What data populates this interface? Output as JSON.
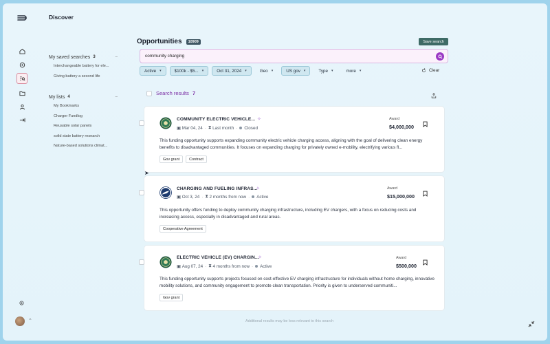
{
  "page": {
    "title": "Discover"
  },
  "sidebar": {
    "saved_searches": {
      "title": "My saved searches",
      "count": "3",
      "items": [
        "Interchangeable battery for ele...",
        "Giving battery a second life"
      ]
    },
    "my_lists": {
      "title": "My lists",
      "count": "4",
      "items": [
        "My Bookmarks",
        "Charger Fundlog",
        "Reusable solar panels",
        "solid state battery research",
        "Nature-based solutions climat..."
      ]
    }
  },
  "main": {
    "title": "Opportunities",
    "total_badge": "10909",
    "save_search_label": "Save search",
    "search_query": "community charging",
    "filters": [
      {
        "label": "Active",
        "active": true
      },
      {
        "label": "$100k - $5...",
        "active": true
      },
      {
        "label": "Oct 31, 2024",
        "active": true
      },
      {
        "label": "Geo",
        "active": false
      },
      {
        "label": "US gov",
        "active": true
      },
      {
        "label": "Type",
        "active": false
      },
      {
        "label": "more",
        "active": false
      }
    ],
    "clear_label": "Clear",
    "results_label": "Search results",
    "results_count": "7",
    "footer_note": "Additional results may be less relevant to this search"
  },
  "results": [
    {
      "name": "COMMUNITY ELECTRIC VEHICLE...",
      "date": "Mar 04, 24",
      "due": "Last month",
      "status": "Closed",
      "status_color": "#8a96a3",
      "award_label": "Award",
      "award": "$4,000,000",
      "description": "This funding opportunity supports expanding community electric vehicle charging access, aligning with the goal of delivering clean energy benefits to disadvantaged communities. It focuses on expanding charging for privately owned e-mobility, electrifying various fl...",
      "tags": [
        "Gov grant",
        "Contract"
      ],
      "seal": "doe"
    },
    {
      "name": "CHARGING AND FUELING INFRAS...",
      "date": "Oct 3, 24",
      "due": "2 months from now",
      "status": "Active",
      "status_color": "#8a96a3",
      "award_label": "Award",
      "award": "$15,000,000",
      "description": "This opportunity offers funding to deploy community charging infrastructure, including EV chargers, with a focus on reducing costs and increasing access, especially in disadvantaged and rural areas.",
      "tags": [
        "Cooperative Agreement"
      ],
      "seal": "dot"
    },
    {
      "name": "ELECTRIC VEHICLE (EV) CHARGIN...",
      "date": "Aug 07, 24",
      "due": "4 months from now",
      "status": "Active",
      "status_color": "#8a96a3",
      "award_label": "Award",
      "award": "$500,000",
      "description": "This funding opportunity supports projects focused on cost-effective EV charging infrastructure for individuals without home charging, innovative mobility solutions, and community engagement to promote clean transportation. Priority is given to underserved communiti...",
      "tags": [
        "Gov grant"
      ],
      "seal": "doe"
    }
  ]
}
